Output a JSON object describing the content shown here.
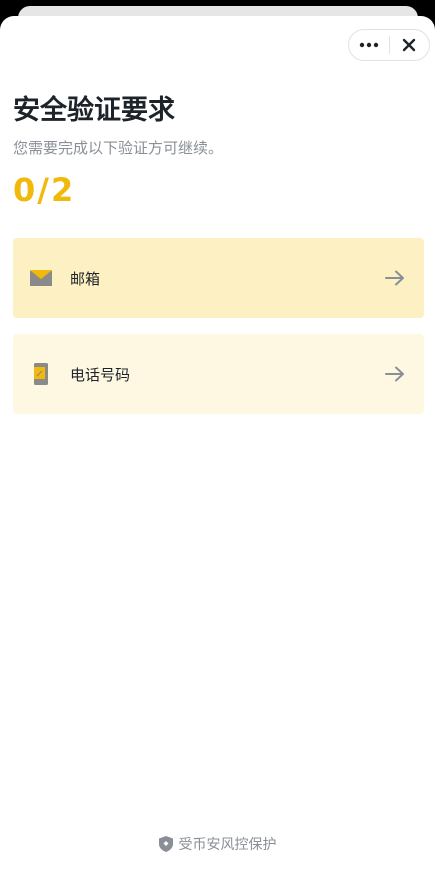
{
  "header": {
    "title": "安全验证要求",
    "subtitle": "您需要完成以下验证方可继续。",
    "progress": "0/2"
  },
  "options": [
    {
      "label": "邮箱",
      "icon": "mail-icon"
    },
    {
      "label": "电话号码",
      "icon": "phone-icon"
    }
  ],
  "footer": {
    "text": "受币安风控保护",
    "icon": "shield-icon"
  },
  "colors": {
    "accent": "#f0b90b",
    "email_bg": "#fdf0c2",
    "phone_bg": "#fef8e3",
    "text_primary": "#1e2329",
    "text_secondary": "#8a8f97"
  }
}
